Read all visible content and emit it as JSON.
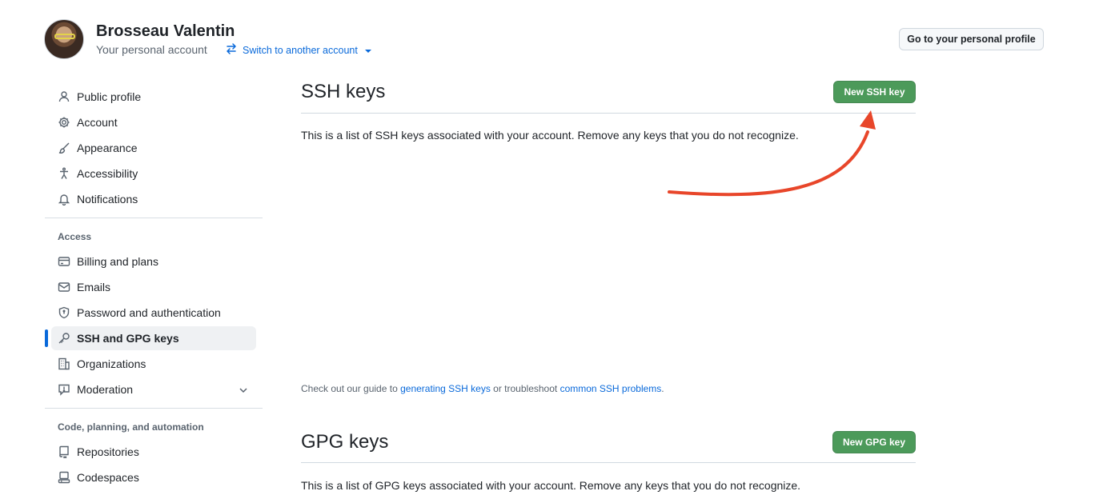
{
  "header": {
    "user_name": "Brosseau Valentin",
    "user_subtitle": "Your personal account",
    "switch_label": "Switch to another account",
    "profile_button": "Go to your personal profile"
  },
  "sidebar": {
    "items_top": [
      {
        "label": "Public profile",
        "icon": "person-icon"
      },
      {
        "label": "Account",
        "icon": "gear-icon"
      },
      {
        "label": "Appearance",
        "icon": "paintbrush-icon"
      },
      {
        "label": "Accessibility",
        "icon": "accessibility-icon"
      },
      {
        "label": "Notifications",
        "icon": "bell-icon"
      }
    ],
    "access_heading": "Access",
    "items_access": [
      {
        "label": "Billing and plans",
        "icon": "credit-card-icon"
      },
      {
        "label": "Emails",
        "icon": "mail-icon"
      },
      {
        "label": "Password and authentication",
        "icon": "shield-lock-icon"
      },
      {
        "label": "SSH and GPG keys",
        "icon": "key-icon",
        "active": true
      },
      {
        "label": "Organizations",
        "icon": "organization-icon"
      },
      {
        "label": "Moderation",
        "icon": "report-icon",
        "expandable": true
      }
    ],
    "code_heading": "Code, planning, and automation",
    "items_code": [
      {
        "label": "Repositories",
        "icon": "repo-icon"
      },
      {
        "label": "Codespaces",
        "icon": "codespaces-icon"
      }
    ]
  },
  "ssh": {
    "title": "SSH keys",
    "new_button": "New SSH key",
    "description": "This is a list of SSH keys associated with your account. Remove any keys that you do not recognize.",
    "guide_prefix": "Check out our guide to",
    "guide_link1": "generating SSH keys",
    "guide_middle": "or troubleshoot",
    "guide_link2": "common SSH problems",
    "guide_suffix": "."
  },
  "gpg": {
    "title": "GPG keys",
    "new_button": "New GPG key",
    "description": "This is a list of GPG keys associated with your account. Remove any keys that you do not recognize."
  },
  "colors": {
    "accent": "#0969da",
    "button_green": "#4c9a5a",
    "annotation_arrow": "#e8462a"
  }
}
